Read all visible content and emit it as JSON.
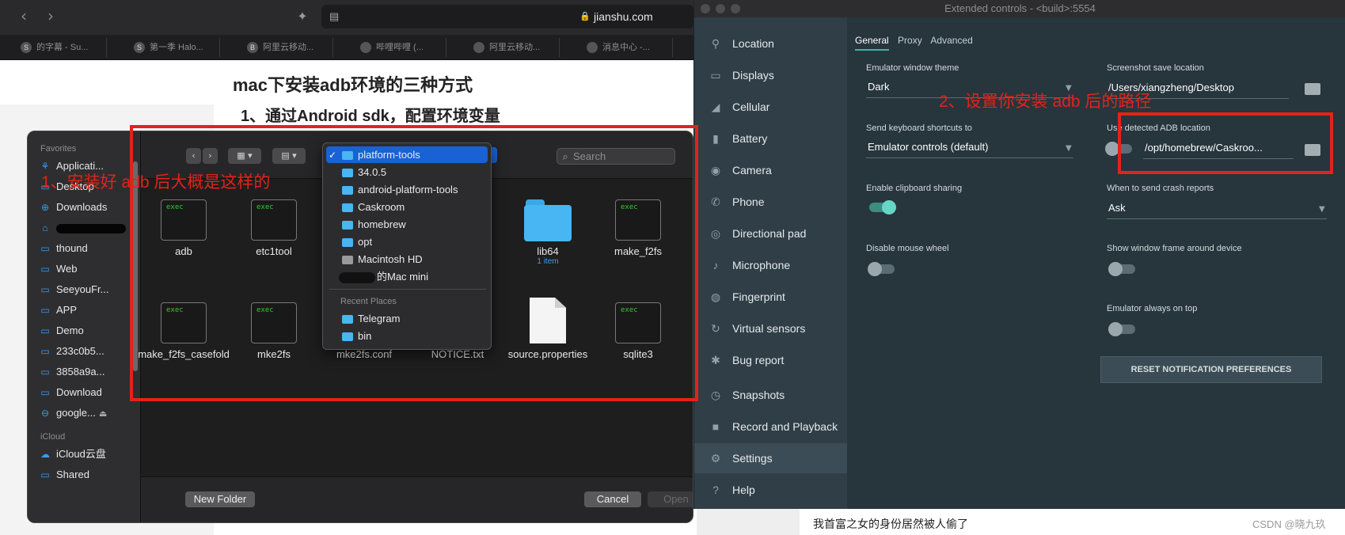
{
  "safari": {
    "url": "jianshu.com",
    "tabs": [
      "的字幕 - Su...",
      "第一季 Halo...",
      "阿里云移动...",
      "哔哩哔哩 (...",
      "阿里云移动...",
      "消息中心 -..."
    ],
    "tab_favicons": [
      "S",
      "S",
      "B",
      "",
      "",
      ""
    ],
    "article_title": "mac下安装adb环境的三种方式",
    "article_subtitle": "1、通过Android sdk，配置环境变量",
    "bottom_text": "我首富之女的身份居然被人偷了",
    "watermark": "CSDN @晓九玖"
  },
  "finder": {
    "favorites_header": "Favorites",
    "favorites": [
      "Applicati...",
      "Desktop",
      "Downloads",
      "",
      "thound",
      "Web",
      "SeeyouFr...",
      "APP",
      "Demo",
      "233c0b5...",
      "3858a9a...",
      "Download",
      "google..."
    ],
    "icloud_header": "iCloud",
    "icloud": [
      "iCloud云盘",
      "Shared"
    ],
    "search_placeholder": "Search",
    "files": [
      {
        "name": "adb",
        "kind": "exec",
        "sub": ""
      },
      {
        "name": "etc1tool",
        "kind": "exec",
        "sub": ""
      },
      {
        "name": "lib64",
        "kind": "folder",
        "sub": "1 item"
      },
      {
        "name": "make_f2fs",
        "kind": "exec",
        "sub": ""
      },
      {
        "name": "make_f2fs_casefold",
        "kind": "exec",
        "sub": ""
      },
      {
        "name": "mke2fs",
        "kind": "exec",
        "sub": ""
      },
      {
        "name": "mke2fs.conf",
        "kind": "doc",
        "sub": ""
      },
      {
        "name": "NOTICE.txt",
        "kind": "doc",
        "sub": ""
      },
      {
        "name": "source.properties",
        "kind": "doc",
        "sub": ""
      },
      {
        "name": "sqlite3",
        "kind": "exec",
        "sub": ""
      }
    ],
    "exec_label": "exec",
    "dropdown": {
      "items": [
        "platform-tools",
        "34.0.5",
        "android-platform-tools",
        "Caskroom",
        "homebrew",
        "opt",
        "Macintosh HD",
        "的Mac mini"
      ],
      "recent_header": "Recent Places",
      "recent": [
        "Telegram",
        "bin"
      ]
    },
    "new_folder": "New Folder",
    "cancel": "Cancel",
    "open": "Open"
  },
  "emulator": {
    "title": "Extended controls - <build>:5554",
    "nav": [
      "Location",
      "Displays",
      "Cellular",
      "Battery",
      "Camera",
      "Phone",
      "Directional pad",
      "Microphone",
      "Fingerprint",
      "Virtual sensors",
      "Bug report",
      "Snapshots",
      "Record and Playback",
      "Settings",
      "Help"
    ],
    "nav_icons": [
      "location-pin-icon",
      "display-icon",
      "cellular-signal-icon",
      "battery-icon",
      "camera-icon",
      "phone-icon",
      "dpad-icon",
      "microphone-icon",
      "fingerprint-icon",
      "virtual-sensors-icon",
      "bug-icon",
      "snapshot-clock-icon",
      "record-camera-icon",
      "settings-gear-icon",
      "help-icon"
    ],
    "active_nav": "Settings",
    "tabs": [
      "General",
      "Proxy",
      "Advanced"
    ],
    "settings": {
      "theme_label": "Emulator window theme",
      "theme_value": "Dark",
      "screenshot_label": "Screenshot save location",
      "screenshot_value": "/Users/xiangzheng/Desktop",
      "shortcuts_label": "Send keyboard shortcuts to",
      "shortcuts_value": "Emulator controls (default)",
      "adb_label": "Use detected ADB location",
      "adb_value": "/opt/homebrew/Caskroo...",
      "clipboard_label": "Enable clipboard sharing",
      "crash_label": "When to send crash reports",
      "crash_value": "Ask",
      "mousewheel_label": "Disable mouse wheel",
      "frame_label": "Show window frame around device",
      "ontop_label": "Emulator always on top",
      "reset_label": "RESET NOTIFICATION PREFERENCES"
    },
    "toggles": {
      "clipboard": true,
      "adb_detected": false,
      "mousewheel": false,
      "frame": false,
      "ontop": false
    }
  },
  "annotations": {
    "left": "1、安装好 adb 后大概是这样的",
    "right": "2、设置你安装 adb 后的路径",
    "color": "#e2231a"
  }
}
